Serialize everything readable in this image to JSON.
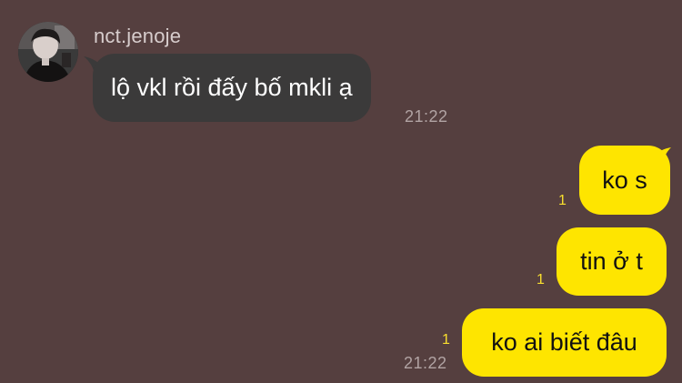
{
  "incoming": {
    "sender_name": "nct.jenoje",
    "message": "lộ vkl rồi đấy bố mkli ạ",
    "time": "21:22"
  },
  "outgoing": [
    {
      "text": "ko s",
      "read_count": "1"
    },
    {
      "text": "tin ở t",
      "read_count": "1"
    },
    {
      "text": "ko ai biết đâu",
      "read_count": "1",
      "time": "21:22"
    }
  ],
  "colors": {
    "background": "#553f3f",
    "incoming_bubble": "#3b3a3a",
    "outgoing_bubble": "#fee500",
    "read_count": "#f9df2e"
  }
}
